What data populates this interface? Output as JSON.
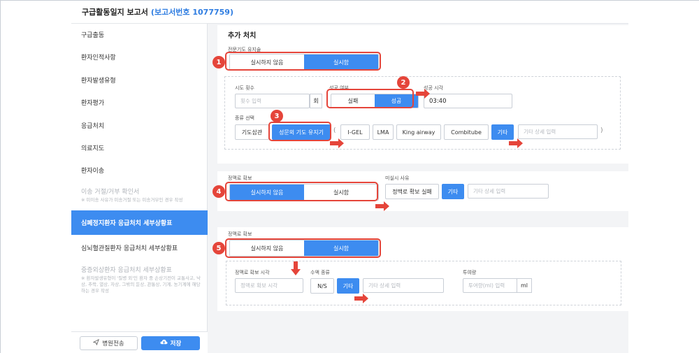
{
  "title": {
    "text": "구급활동일지 보고서",
    "report_no": "(보고서번호 1077759)"
  },
  "sidebar": {
    "items": [
      {
        "label": "구급출동"
      },
      {
        "label": "환자인적사항"
      },
      {
        "label": "환자발생유형"
      },
      {
        "label": "환자평가"
      },
      {
        "label": "응급처치"
      },
      {
        "label": "의료지도"
      },
      {
        "label": "환자이송"
      },
      {
        "label": "이송 거절/거부 확인서",
        "note": "※ 미이송 사유가 미송거절 또는 미송거부인 경우 작성"
      },
      {
        "label": "심폐정지환자 응급처치 세부상황표"
      },
      {
        "label": "심뇌혈관질환자 응급처치 세부상황표"
      },
      {
        "label": "중증외상환자 응급처치 세부상황표",
        "note": "※ 환자발생유형이 '질병 외'인 환자 중 손상기전이 교통사고, 낙상, 추락, 열상, 자상, 그밖의 둔상, 관통상, 기계, 농기계에 해당하는 경우 작성"
      }
    ],
    "transfer_label": "병원전송",
    "save_label": "저장"
  },
  "section1": {
    "heading": "추가 처치",
    "airway_label": "전문기도 유지술",
    "airway_options": [
      "실시하지 않음",
      "실시함"
    ],
    "airway_selected": "실시함",
    "attempts_label": "시도 횟수",
    "attempts_placeholder": "횟수 입력",
    "attempts_unit": "회",
    "success_label": "성공 여부",
    "success_options": [
      "실패",
      "성공"
    ],
    "success_selected": "성공",
    "time_label": "성공 시각",
    "time_value": "03:40",
    "type_label": "종류 선택",
    "types": [
      "기도삽관",
      "성문외 기도 유지기",
      "I-GEL",
      "LMA",
      "King airway",
      "Combitube",
      "기타"
    ],
    "types_selected": [
      "성문외 기도 유지기",
      "기타"
    ],
    "etc_placeholder": "기타 상세 입력",
    "paren_open": "(",
    "paren_close": ")"
  },
  "section2": {
    "iv_label": "정맥로 확보",
    "iv_options": [
      "실시하지 않음",
      "실시함"
    ],
    "iv_selected": "실시하지 않음",
    "reason_label": "미실시 사유",
    "reasons": [
      "정맥로 확보 실패",
      "기타"
    ],
    "reasons_selected": "기타",
    "etc_placeholder": "기타 상세 입력"
  },
  "section3": {
    "iv_label": "정맥로 확보",
    "iv_options": [
      "실시하지 않음",
      "실시함"
    ],
    "iv_selected": "실시함",
    "iv_time_label": "정맥로 확보 시각",
    "iv_time_placeholder": "정맥로 확보 시각",
    "fluid_label": "수액 종류",
    "fluids": [
      "N/S",
      "기타"
    ],
    "fluid_selected": "기타",
    "fluid_etc_placeholder": "기타 상세 입력",
    "dose_label": "투여량",
    "dose_placeholder": "투여량(ml) 입력",
    "dose_unit": "ml"
  },
  "callouts": [
    "1",
    "2",
    "3",
    "4",
    "5"
  ],
  "colors": {
    "accent": "#3d8cf0",
    "highlight": "#e5453a",
    "report_no": "#2f7de1"
  }
}
